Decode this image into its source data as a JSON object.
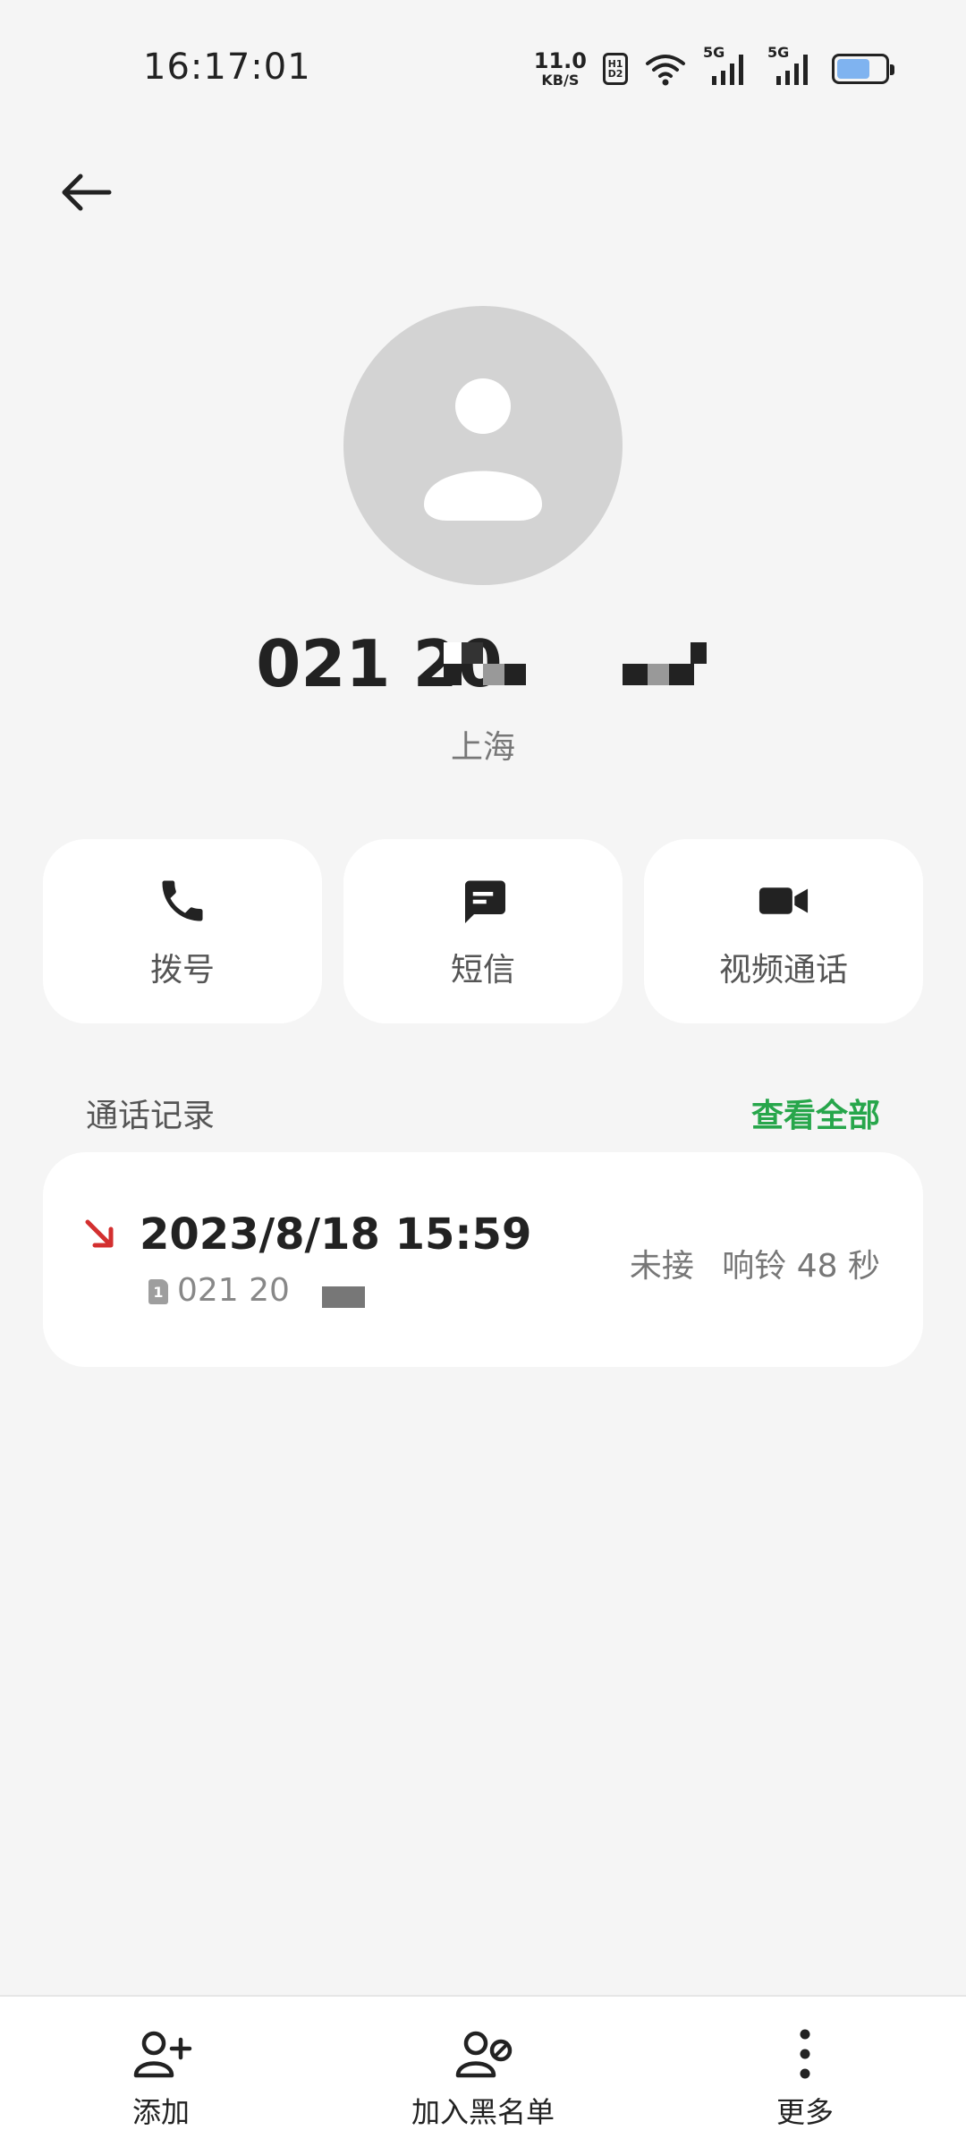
{
  "status_bar": {
    "time": "16:17:01",
    "net_speed_value": "11.0",
    "net_speed_unit": "KB/S",
    "hd_top": "H1",
    "hd_bottom": "D2",
    "signal1_label": "5G",
    "signal2_label": "5G"
  },
  "contact": {
    "number": "021 20",
    "location": "上海"
  },
  "actions": {
    "dial": "拨号",
    "sms": "短信",
    "video": "视频通话"
  },
  "call_log": {
    "title": "通话记录",
    "view_all": "查看全部",
    "entries": [
      {
        "datetime": "2023/8/18 15:59",
        "sim": "1",
        "number": "021 20",
        "status": "未接",
        "ring": "响铃 48 秒"
      }
    ]
  },
  "bottom_bar": {
    "add": "添加",
    "block": "加入黑名单",
    "more": "更多"
  },
  "colors": {
    "accent": "#27a64b",
    "missed": "#d32f2f",
    "avatar_bg": "#d3d3d3",
    "background": "#f5f5f5"
  },
  "icons": [
    "back-arrow-icon",
    "person-icon",
    "phone-icon",
    "message-icon",
    "video-camera-icon",
    "missed-call-icon",
    "sim-card-icon",
    "add-contact-icon",
    "block-contact-icon",
    "more-vertical-icon"
  ]
}
